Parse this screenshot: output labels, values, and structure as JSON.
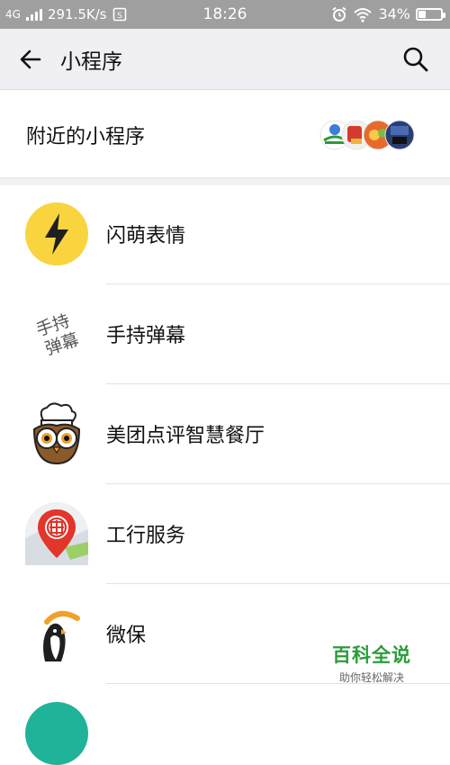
{
  "status_bar": {
    "network": "4G",
    "speed": "291.5K/s",
    "time": "18:26",
    "battery_percent": "34%",
    "battery_level": 0.34
  },
  "header": {
    "title": "小程序"
  },
  "nearby": {
    "label": "附近的小程序"
  },
  "list": [
    {
      "name": "闪萌表情",
      "icon": "lightning-bolt-icon"
    },
    {
      "name": "手持弹幕",
      "icon": "handheld-danmu-icon",
      "icon_text": [
        "手持",
        "弹幕"
      ]
    },
    {
      "name": "美团点评智慧餐厅",
      "icon": "chef-owl-icon"
    },
    {
      "name": "工行服务",
      "icon": "icbc-pin-icon"
    },
    {
      "name": "微保",
      "icon": "penguin-umbrella-icon"
    }
  ],
  "watermark": {
    "title": "百科全说",
    "subtitle": "助你轻松解决"
  }
}
